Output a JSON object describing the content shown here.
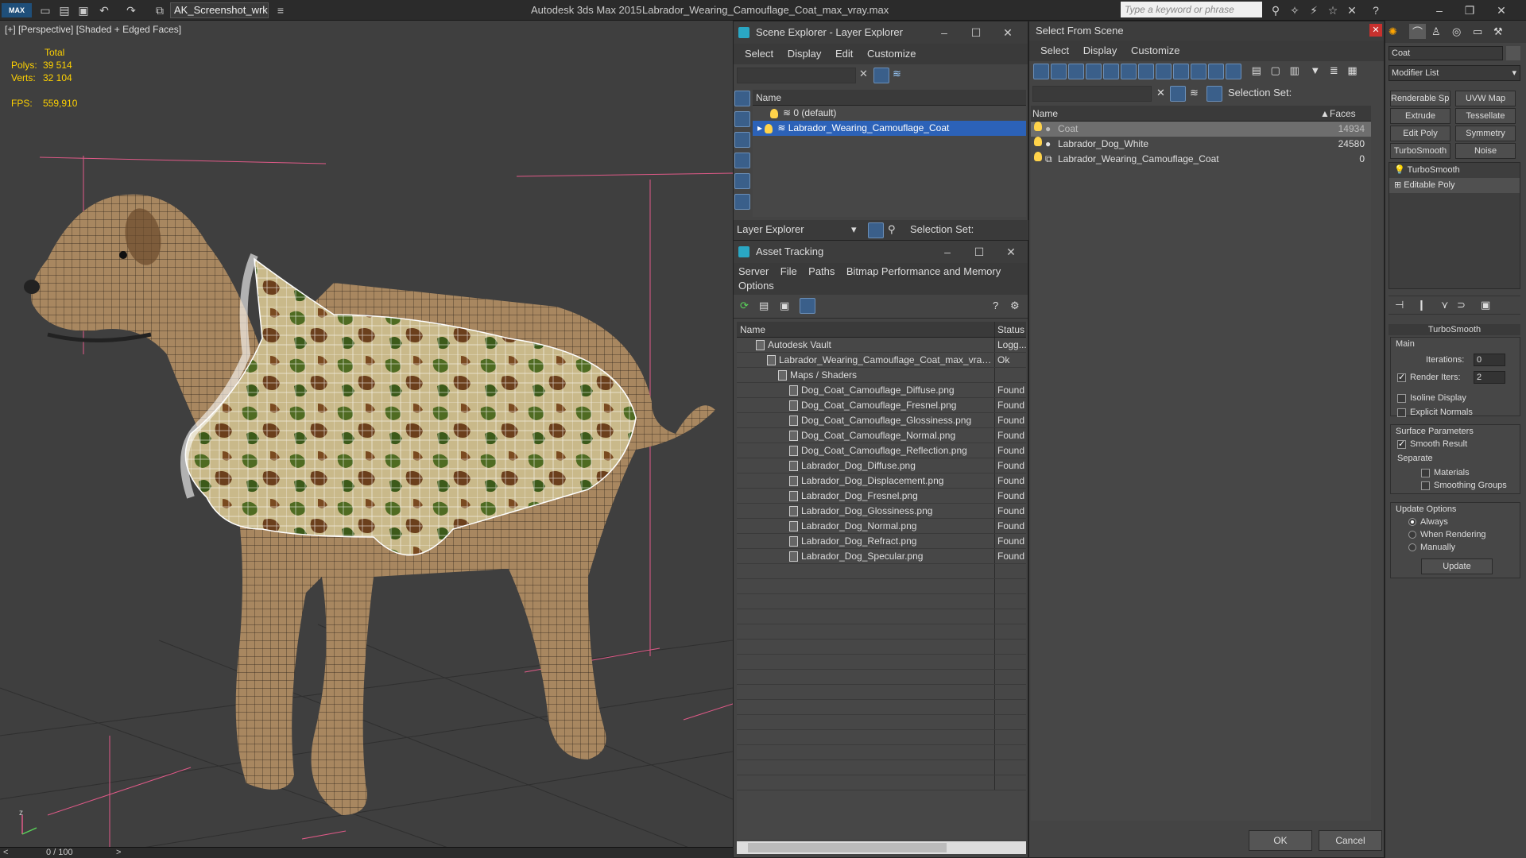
{
  "titlebar": {
    "logo": "MAX",
    "workspace": "AK_Screenshot_wrksp",
    "app_title": "Autodesk 3ds Max  2015",
    "file_title": "Labrador_Wearing_Camouflage_Coat_max_vray.max",
    "search_placeholder": "Type a keyword or phrase"
  },
  "viewport": {
    "label": "[+] [Perspective] [Shaded + Edged Faces]",
    "stats_total": "Total",
    "polys_label": "Polys:",
    "polys_value": "39 514",
    "verts_label": "Verts:",
    "verts_value": "32 104",
    "fps_label": "FPS:",
    "fps_value": "559,910",
    "timeline": "0 / 100"
  },
  "scene_explorer": {
    "title": "Scene Explorer - Layer Explorer",
    "menu": [
      "Select",
      "Display",
      "Edit",
      "Customize"
    ],
    "col_name": "Name",
    "layers": [
      "0 (default)",
      "Labrador_Wearing_Camouflage_Coat"
    ],
    "footer_dropdown": "Layer Explorer",
    "selection_set_label": "Selection Set:"
  },
  "asset_tracking": {
    "title": "Asset Tracking",
    "menu": [
      "Server",
      "File",
      "Paths",
      "Bitmap Performance and Memory",
      "Options"
    ],
    "col_name": "Name",
    "col_status": "Status",
    "rows": [
      {
        "name": "Autodesk Vault",
        "status": "Logg..."
      },
      {
        "name": "Labrador_Wearing_Camouflage_Coat_max_vray....",
        "status": "Ok"
      },
      {
        "name": "Maps / Shaders",
        "status": ""
      },
      {
        "name": "Dog_Coat_Camouflage_Diffuse.png",
        "status": "Found"
      },
      {
        "name": "Dog_Coat_Camouflage_Fresnel.png",
        "status": "Found"
      },
      {
        "name": "Dog_Coat_Camouflage_Glossiness.png",
        "status": "Found"
      },
      {
        "name": "Dog_Coat_Camouflage_Normal.png",
        "status": "Found"
      },
      {
        "name": "Dog_Coat_Camouflage_Reflection.png",
        "status": "Found"
      },
      {
        "name": "Labrador_Dog_Diffuse.png",
        "status": "Found"
      },
      {
        "name": "Labrador_Dog_Displacement.png",
        "status": "Found"
      },
      {
        "name": "Labrador_Dog_Fresnel.png",
        "status": "Found"
      },
      {
        "name": "Labrador_Dog_Glossiness.png",
        "status": "Found"
      },
      {
        "name": "Labrador_Dog_Normal.png",
        "status": "Found"
      },
      {
        "name": "Labrador_Dog_Refract.png",
        "status": "Found"
      },
      {
        "name": "Labrador_Dog_Specular.png",
        "status": "Found"
      }
    ]
  },
  "select_from_scene": {
    "title": "Select From Scene",
    "menu": [
      "Select",
      "Display",
      "Customize"
    ],
    "selection_set_label": "Selection Set:",
    "col_name": "Name",
    "col_faces": "Faces",
    "rows": [
      {
        "name": "Coat",
        "faces": "14934"
      },
      {
        "name": "Labrador_Dog_White",
        "faces": "24580"
      },
      {
        "name": "Labrador_Wearing_Camouflage_Coat",
        "faces": "0"
      }
    ],
    "ok": "OK",
    "cancel": "Cancel"
  },
  "command_panel": {
    "object_name": "Coat",
    "modifier_list": "Modifier List",
    "buttons": [
      "Renderable Spline",
      "UVW Map",
      "Extrude",
      "Tessellate",
      "Edit Poly",
      "Symmetry",
      "TurboSmooth",
      "Noise"
    ],
    "stack": [
      "TurboSmooth",
      "Editable Poly"
    ],
    "rollout_title": "TurboSmooth",
    "main_label": "Main",
    "iterations_label": "Iterations:",
    "iterations_value": "0",
    "render_iters_label": "Render Iters:",
    "render_iters_value": "2",
    "isoline": "Isoline Display",
    "explicit_normals": "Explicit Normals",
    "surface_params": "Surface Parameters",
    "smooth_result": "Smooth Result",
    "separate": "Separate",
    "materials": "Materials",
    "smoothing_groups": "Smoothing Groups",
    "update_options": "Update Options",
    "always": "Always",
    "when_rendering": "When Rendering",
    "manually": "Manually",
    "update": "Update"
  }
}
